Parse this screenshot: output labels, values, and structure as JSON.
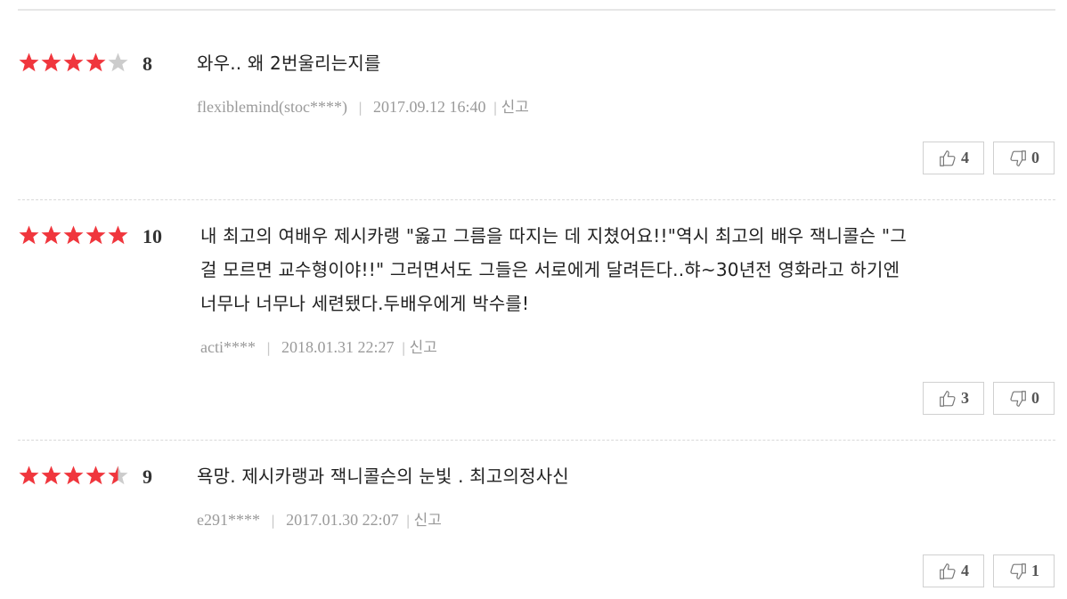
{
  "reviews": [
    {
      "rating": 4,
      "score": "8",
      "text": "와우.. 왜 2번울리는지를",
      "author": "flexiblemind(stoc****)",
      "date": "2017.09.12 16:40",
      "report_label": "신고",
      "likes": "4",
      "dislikes": "0"
    },
    {
      "rating": 5,
      "score": "10",
      "text_lines": [
        "내 최고의 여배우 제시카랭 \"옳고 그름을 따지는 데 지쳤어요!!\"역시 최고의 배우 잭니콜슨 \"그",
        "걸 모르면 교수형이야!!\" 그러면서도 그들은 서로에게 달려든다..햐~30년전 영화라고 하기엔",
        "너무나 너무나 세련됐다.두배우에게 박수를!"
      ],
      "author": "acti****",
      "date": "2018.01.31 22:27",
      "report_label": "신고",
      "likes": "3",
      "dislikes": "0"
    },
    {
      "rating": 4.5,
      "score": "9",
      "text": "욕망. 제시카랭과 잭니콜슨의 눈빛 . 최고의정사신",
      "author": "e291****",
      "date": "2017.01.30 22:07",
      "report_label": "신고",
      "likes": "4",
      "dislikes": "1"
    }
  ],
  "colors": {
    "star_on": "#f0363d",
    "star_off": "#cccccc"
  },
  "icons": {
    "like": "thumbs-up-icon",
    "dislike": "thumbs-down-icon"
  }
}
